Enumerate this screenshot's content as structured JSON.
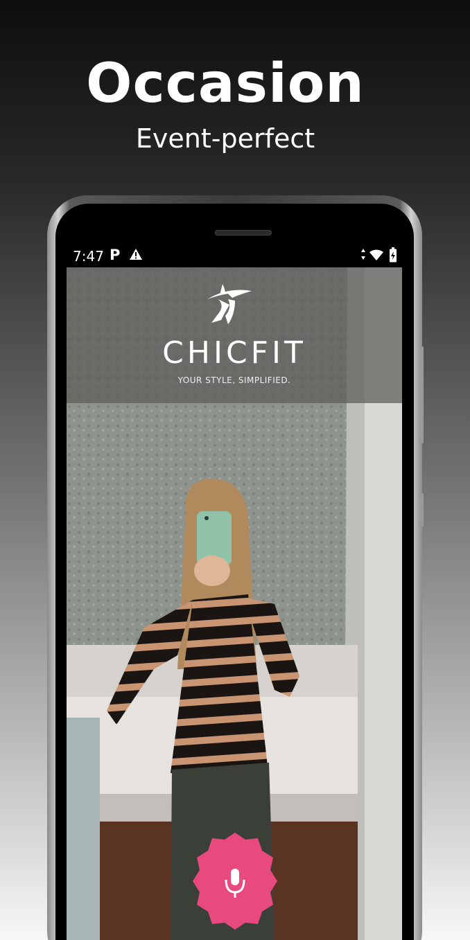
{
  "hero": {
    "title": "Occasion",
    "subtitle": "Event-perfect"
  },
  "status_bar": {
    "time": "7:47",
    "parking_glyph": "P"
  },
  "app": {
    "brand": "CHICFIT",
    "tagline": "YOUR STYLE, SIMPLIFIED.",
    "logo_icon": "woman-in-hat-icon"
  },
  "actions": {
    "mic_icon": "microphone-icon"
  },
  "colors": {
    "mic_button": "#e84a7f",
    "banner_overlay": "#5c5c58",
    "sweater_stripe": "#c89472",
    "phone_case": "#8fc2a8"
  }
}
